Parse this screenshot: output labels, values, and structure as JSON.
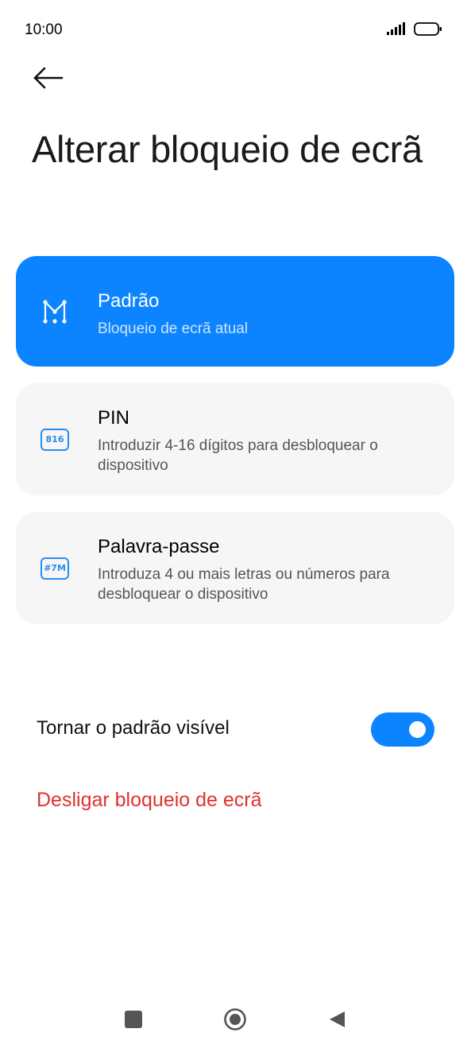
{
  "status_bar": {
    "time": "10:00",
    "icons": [
      "signal-icon",
      "battery-icon"
    ]
  },
  "header": {
    "back_icon": "arrow-left-icon",
    "title": "Alterar bloqueio de ecrã"
  },
  "options": [
    {
      "title": "Padrão",
      "subtitle": "Bloqueio de ecrã atual",
      "icon": "pattern-icon",
      "selected": true
    },
    {
      "title": "PIN",
      "subtitle": "Introduzir 4-16 dígitos para desbloquear o dispositivo",
      "icon_text": "816",
      "icon": "pin-icon",
      "selected": false
    },
    {
      "title": "Palavra-passe",
      "subtitle": "Introduza 4 ou mais letras ou números para desbloquear o dispositivo",
      "icon_text": "#7M",
      "icon": "password-icon",
      "selected": false
    }
  ],
  "toggle": {
    "label": "Tornar o padrão visível",
    "on": true
  },
  "disable_link": "Desligar bloqueio de ecrã",
  "colors": {
    "accent": "#0d84ff",
    "danger": "#e0312f",
    "card_bg": "#f6f6f6"
  },
  "nav_bar": {
    "icons": [
      "recent-apps-icon",
      "home-icon",
      "back-triangle-icon"
    ]
  }
}
